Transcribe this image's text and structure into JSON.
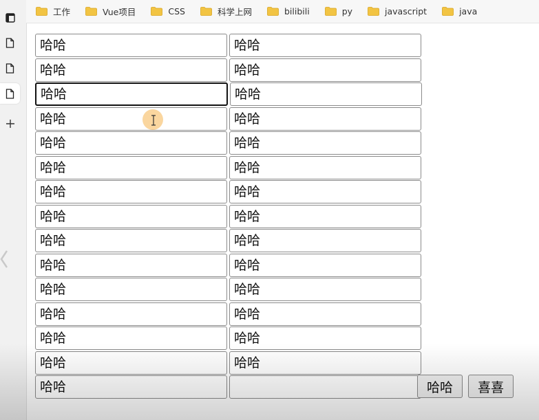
{
  "bookmarks": [
    {
      "label": "工作",
      "icon": "folder-icon"
    },
    {
      "label": "Vue项目",
      "icon": "folder-icon"
    },
    {
      "label": "CSS",
      "icon": "folder-icon"
    },
    {
      "label": "科学上网",
      "icon": "folder-icon"
    },
    {
      "label": "bilibili",
      "icon": "folder-icon"
    },
    {
      "label": "py",
      "icon": "folder-icon"
    },
    {
      "label": "javascript",
      "icon": "folder-icon"
    },
    {
      "label": "java",
      "icon": "folder-icon"
    }
  ],
  "sidebar": {
    "icons": [
      "window-icon",
      "document-icon",
      "document-icon",
      "document-icon",
      "plus-icon"
    ],
    "active_index": 3
  },
  "grid": {
    "rows": [
      [
        "哈哈",
        "哈哈"
      ],
      [
        "哈哈",
        "哈哈"
      ],
      [
        "哈哈",
        "哈哈"
      ],
      [
        "哈哈",
        "哈哈"
      ],
      [
        "哈哈",
        "哈哈"
      ],
      [
        "哈哈",
        "哈哈"
      ],
      [
        "哈哈",
        "哈哈"
      ],
      [
        "哈哈",
        "哈哈"
      ],
      [
        "哈哈",
        "哈哈"
      ],
      [
        "哈哈",
        "哈哈"
      ],
      [
        "哈哈",
        "哈哈"
      ],
      [
        "哈哈",
        "哈哈"
      ],
      [
        "哈哈",
        "哈哈"
      ],
      [
        "哈哈",
        "哈哈"
      ],
      [
        "哈哈",
        ""
      ]
    ],
    "focused_row": 2,
    "focused_col": 0
  },
  "buttons": {
    "haha_label": "哈哈",
    "xixi_label": "喜喜"
  },
  "colors": {
    "folder": "#f2c443",
    "cursor_highlight": "#f5b450"
  }
}
